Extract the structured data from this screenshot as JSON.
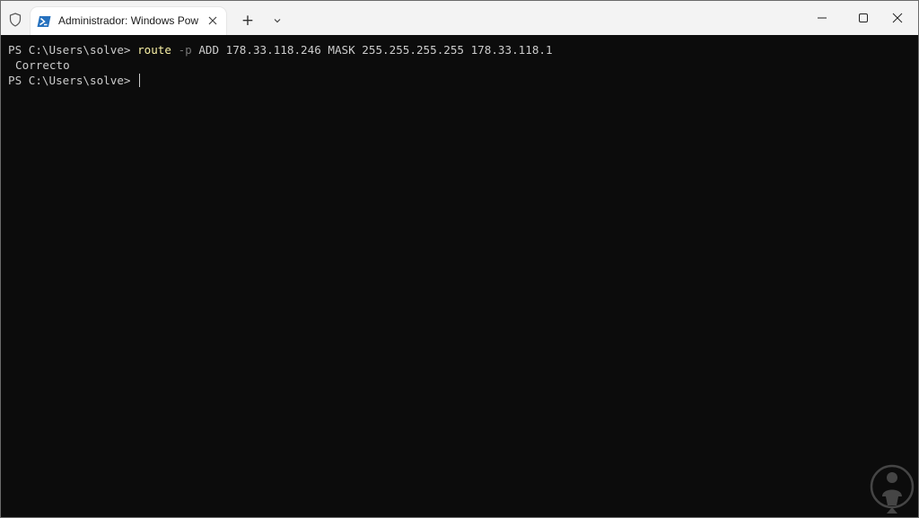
{
  "tab": {
    "title": "Administrador: Windows Pow"
  },
  "icons": {
    "shield": "shield-icon",
    "powershell": "powershell-icon",
    "close_tab": "close-icon",
    "new_tab": "plus-icon",
    "dropdown": "chevron-down-icon",
    "minimize": "minimize-icon",
    "maximize": "maximize-icon",
    "close_window": "close-icon"
  },
  "new_tab_glyph": "+",
  "terminal": {
    "prompt": "PS C:\\Users\\solve> ",
    "command": "route",
    "flag": " -p",
    "args": " ADD 178.33.118.246 MASK 255.255.255.255 178.33.118.1",
    "output": "Correcto",
    "prompt2": "PS C:\\Users\\solve> "
  },
  "colors": {
    "terminal_bg": "#0c0c0c",
    "text": "#cccccc",
    "command": "#f9f1a5",
    "flag": "#767676",
    "titlebar": "#f3f3f3"
  }
}
